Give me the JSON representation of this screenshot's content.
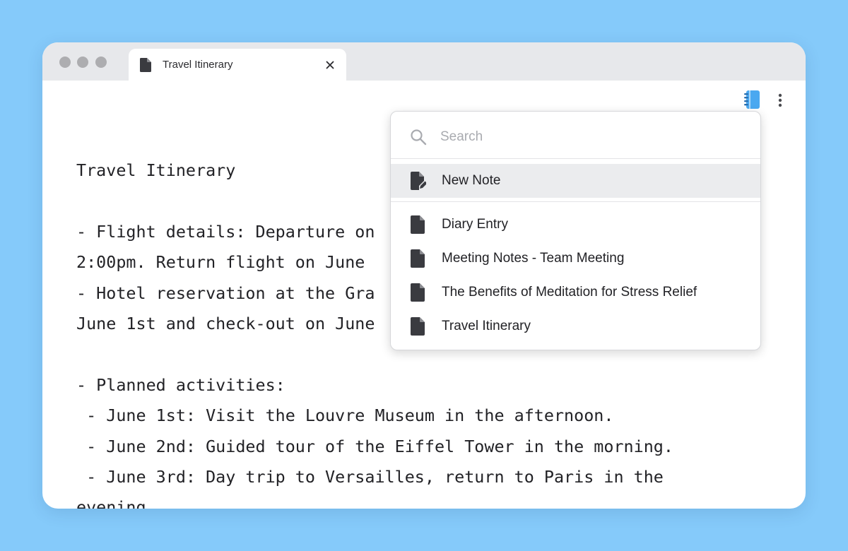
{
  "colors": {
    "background": "#85cafa",
    "titlebar": "#e7e8eb",
    "extension_accent": "#4aa8f0",
    "highlight_row": "#ebecee"
  },
  "tab": {
    "title": "Travel Itinerary",
    "icon": "document-icon",
    "close_icon": "close-icon"
  },
  "toolbar": {
    "extension_icon": "notebook-icon",
    "more_icon": "more-vertical-icon"
  },
  "editor": {
    "lines": [
      "Travel Itinerary",
      "",
      "- Flight details: Departure on",
      "2:00pm. Return flight on June",
      "- Hotel reservation at the Gra",
      "June 1st and check-out on June",
      "",
      "- Planned activities:",
      " - June 1st: Visit the Louvre Museum in the afternoon.",
      " - June 2nd: Guided tour of the Eiffel Tower in the morning.",
      " - June 3rd: Day trip to Versailles, return to Paris in the",
      "evening."
    ]
  },
  "popup": {
    "search": {
      "placeholder": "Search",
      "value": "",
      "icon": "search-icon"
    },
    "new_note": {
      "label": "New Note",
      "icon": "new-note-icon"
    },
    "notes": [
      {
        "label": "Diary Entry",
        "icon": "document-icon"
      },
      {
        "label": "Meeting Notes - Team Meeting",
        "icon": "document-icon"
      },
      {
        "label": "The Benefits of Meditation for Stress Relief",
        "icon": "document-icon"
      },
      {
        "label": "Travel Itinerary",
        "icon": "document-icon"
      }
    ]
  }
}
